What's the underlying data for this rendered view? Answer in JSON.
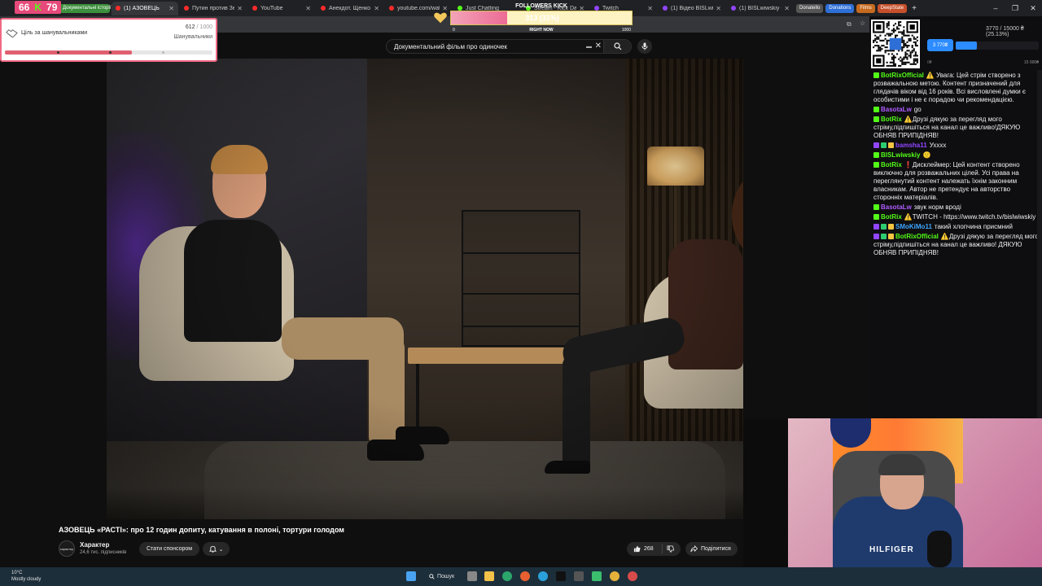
{
  "browser": {
    "tabs": [
      {
        "label": "Документальні історії",
        "type": "pill-green"
      },
      {
        "label": "(1) АЗОВЕЦЬ",
        "active": true,
        "icon": "youtube"
      },
      {
        "label": "Путин против Зе",
        "icon": "youtube"
      },
      {
        "label": "YouTube",
        "icon": "youtube"
      },
      {
        "label": "Анекдот. Щенко",
        "icon": "youtube"
      },
      {
        "label": "youtube.com/wat",
        "icon": "youtube"
      },
      {
        "label": "Just Chatting",
        "icon": "kick"
      },
      {
        "label": "Stream - Kick Das",
        "icon": "kick"
      },
      {
        "label": "Twitch",
        "icon": "twitch"
      },
      {
        "label": "(1) Відео BISLwiw",
        "icon": "twitch"
      },
      {
        "label": "(1) BISLwiwskiy -",
        "icon": "twitch"
      }
    ],
    "bookmarks": [
      "Donatello",
      "Donations",
      "Films",
      "DeepState"
    ],
    "colors": {
      "tabbar": "#202124",
      "active_tab": "#35363a"
    }
  },
  "youtube": {
    "search_query": "Документальний фільм  про одиночек",
    "video_title": "АЗОВЕЦЬ «РАСТІ»: про 12 годин допиту, катування в полоні, тортури голодом",
    "channel": {
      "name": "Характер",
      "subscribers": "24,6 тис. підписників",
      "avatar_text": "характер"
    },
    "sponsor_label": "Стати спонсором",
    "likes": "268",
    "share_label": "Поділитися"
  },
  "overlays": {
    "counter": {
      "left": "66",
      "right": "79"
    },
    "goal": {
      "title": "Ціль за шанувальниками",
      "current": "612",
      "max": "/ 1000",
      "subtitle": "Шанувальники",
      "progress": 0.612
    },
    "followers": {
      "title": "FOLLOWERS KICK",
      "value": "313 (31%)",
      "min": "0",
      "label": "RIGHT NOW",
      "max": "1000",
      "progress": 0.313
    },
    "donation": {
      "text": "3770 / 15000 ₴ (25.13%)",
      "button": "3 770₴",
      "min": "0₴",
      "max": "15 000₴",
      "progress": 0.2513
    }
  },
  "chat": [
    {
      "user": "BotRixOfficial",
      "color": "#53fc18",
      "badges": [
        "k"
      ],
      "text": "⚠️ Увага: Цей стрім створено з розважальною метою. Контент призначений для глядачів віком від 16 років. Всі висловлені думки є особистими і не є порадою чи рекомендацією."
    },
    {
      "user": "BasotaLw",
      "color": "#b05cff",
      "badges": [
        "k"
      ],
      "text": "go"
    },
    {
      "user": "BotRix",
      "color": "#53fc18",
      "badges": [
        "k"
      ],
      "text": "⚠️Друзі дякую за перегляд мого стріму,підпишіться на канал це важливо!ДЯКУЮ ОБНЯВ ПРИПІДНЯВ!"
    },
    {
      "user": "bamsha11",
      "color": "#9146ff",
      "badges": [
        "tw",
        "g",
        "y"
      ],
      "text": "Ухххх"
    },
    {
      "user": "BISLwiwskiy",
      "color": "#53fc18",
      "badges": [
        "k"
      ],
      "text": "🙂"
    },
    {
      "user": "BotRix",
      "color": "#53fc18",
      "badges": [
        "k"
      ],
      "text": "❗Дисклеймер: Цей контент створено виключно для розважальних цілей. Усі права на переглянутий контент належать їхнім законним власникам. Автор не претендує на авторство сторонніх матеріалів."
    },
    {
      "user": "BasotaLw",
      "color": "#b05cff",
      "badges": [
        "k"
      ],
      "text": "звук норм вроді"
    },
    {
      "user": "BotRix",
      "color": "#53fc18",
      "badges": [
        "k"
      ],
      "text": "⚠️TWITCH - https://www.twitch.tv/bislwiwskiy"
    },
    {
      "user": "SMoKiMo11",
      "color": "#3ea6ff",
      "badges": [
        "tw",
        "g",
        "y"
      ],
      "text": "такий хлопчина присмний"
    },
    {
      "user": "BotRixOfficial",
      "color": "#53fc18",
      "badges": [
        "tw",
        "g",
        "y"
      ],
      "text": "⚠️Друзі дякую за перегляд мого стріму,підпишіться на канал це важливо! ДЯКУЮ ОБНЯВ ПРИПІДНЯВ!"
    }
  ],
  "webcam": {
    "shirt_text": "HILFIGER"
  },
  "taskbar": {
    "weather_temp": "10°C",
    "weather_desc": "Mostly cloudy",
    "search_label": "Пошук"
  }
}
